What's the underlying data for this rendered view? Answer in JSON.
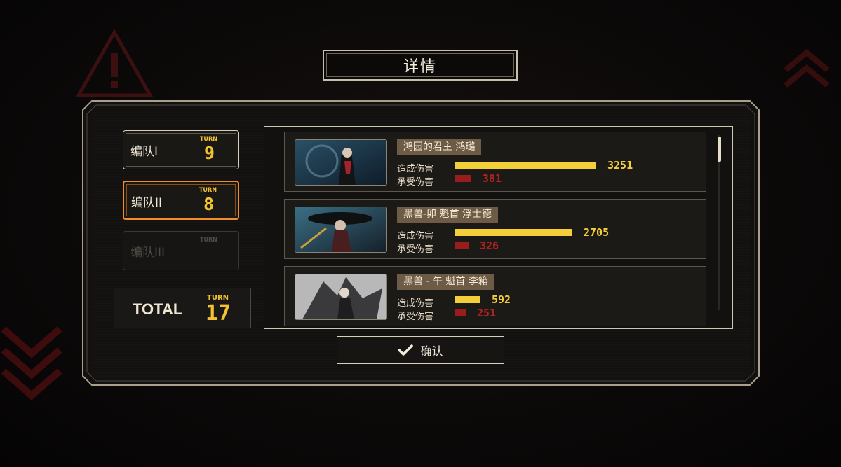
{
  "title": "详情",
  "teams": [
    {
      "name": "编队I",
      "turn_label": "TURN",
      "turn": "9",
      "state": "normal"
    },
    {
      "name": "编队II",
      "turn_label": "TURN",
      "turn": "8",
      "state": "active"
    },
    {
      "name": "编队III",
      "turn_label": "TURN",
      "turn": "",
      "state": "disabled"
    }
  ],
  "total": {
    "label": "TOTAL",
    "turn_label": "TURN",
    "turn": "17"
  },
  "stats": {
    "dealt_label": "造成伤害",
    "taken_label": "承受伤害"
  },
  "characters": [
    {
      "name": "鸿园的君主 鸿璐",
      "dealt": 3251,
      "taken": 381
    },
    {
      "name": "黑兽-卯 魁首 浮士德",
      "dealt": 2705,
      "taken": 326
    },
    {
      "name": "黑兽 - 午 魁首 李箱",
      "dealt": 592,
      "taken": 251
    }
  ],
  "max_damage": 3251,
  "confirm_label": "确认",
  "colors": {
    "accent": "#f2c230",
    "active_border": "#f08c2a",
    "taken_bar": "#9b1c1c"
  }
}
